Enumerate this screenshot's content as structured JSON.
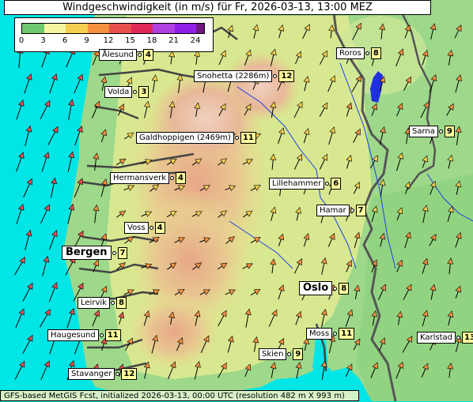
{
  "title": "Windgeschwindigkeit (in m/s) für Fr, 2026-03-13, 13:00 MEZ",
  "legend": {
    "ticks": [
      "0",
      "3",
      "6",
      "9",
      "12",
      "15",
      "18",
      "21",
      "24"
    ],
    "colors": [
      "#6ec86e",
      "#f5f5a0",
      "#f5d050",
      "#f59040",
      "#e85050",
      "#e02858",
      "#b040e0",
      "#9020e8",
      "#701880"
    ]
  },
  "footer": "GFS-based MetGIS Fcst, initialized 2026-03-13, 00:00 UTC  (resolution 482 m X 993 m)",
  "cities": [
    {
      "name": "Ålesund",
      "value": "4"
    },
    {
      "name": "Roros",
      "value": "8"
    },
    {
      "name": "Snohetta (2286m)",
      "value": "12"
    },
    {
      "name": "Volda",
      "value": "3"
    },
    {
      "name": "Sarna",
      "value": "9"
    },
    {
      "name": "Galdhoppigen (2469m)",
      "value": "11"
    },
    {
      "name": "Hermansverk",
      "value": "4"
    },
    {
      "name": "Lillehammer",
      "value": "6"
    },
    {
      "name": "Hamar",
      "value": "7"
    },
    {
      "name": "Voss",
      "value": "4"
    },
    {
      "name": "Bergen",
      "value": "7"
    },
    {
      "name": "Oslo",
      "value": "8"
    },
    {
      "name": "Leirvik",
      "value": "8"
    },
    {
      "name": "Haugesund",
      "value": "11"
    },
    {
      "name": "Moss",
      "value": "11"
    },
    {
      "name": "Karlstad",
      "value": "13"
    },
    {
      "name": "Skien",
      "value": "9"
    },
    {
      "name": "Stavanger",
      "value": "12"
    }
  ]
}
